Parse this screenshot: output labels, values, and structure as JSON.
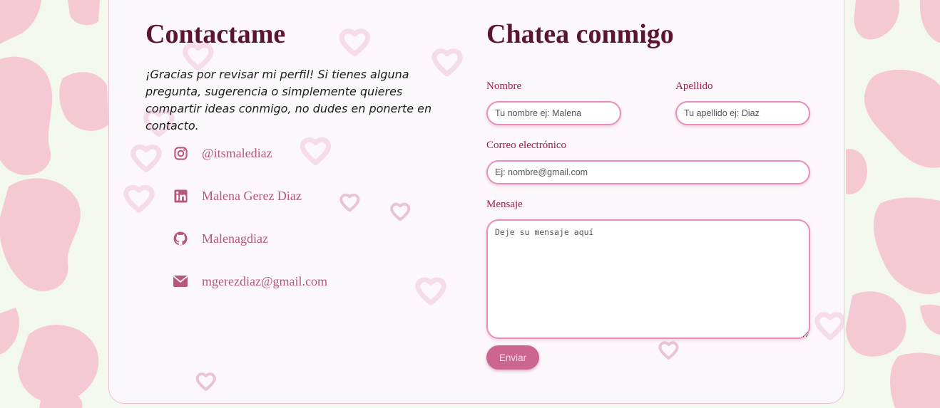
{
  "contact": {
    "title": "Contactame",
    "intro": "¡Gracias por revisar mi perfil! Si tienes alguna pregunta, sugerencia o simplemente quieres compartir ideas conmigo, no dudes en ponerte en contacto.",
    "socials": [
      {
        "icon": "instagram-icon",
        "label": "@itsmalediaz"
      },
      {
        "icon": "linkedin-icon",
        "label": "Malena Gerez Diaz"
      },
      {
        "icon": "github-icon",
        "label": "Malenagdiaz"
      },
      {
        "icon": "envelope-icon",
        "label": "mgerezdiaz@gmail.com"
      }
    ]
  },
  "chat": {
    "title": "Chatea conmigo",
    "nombre": {
      "label": "Nombre",
      "placeholder": "Tu nombre ej: Malena",
      "value": ""
    },
    "apellido": {
      "label": "Apellido",
      "placeholder": "Tu apellido ej: Diaz",
      "value": ""
    },
    "correo": {
      "label": "Correo electrónico",
      "placeholder": "Ej: nombre@gmail.com",
      "value": ""
    },
    "mensaje": {
      "label": "Mensaje",
      "placeholder": "Deje su mensaje aquí",
      "value": ""
    },
    "submit_label": "Enviar"
  },
  "colors": {
    "page_background": "#f2f8ee",
    "cow_spots": "#f4c9d4",
    "card_background": "#fcf7fa",
    "title": "#5c1530",
    "label": "#9d1e4f",
    "link": "#b9567e",
    "icon": "#b9567e",
    "input_border": "#e98ebc",
    "button": "#cc6590",
    "button_text": "#f6d7e4"
  }
}
